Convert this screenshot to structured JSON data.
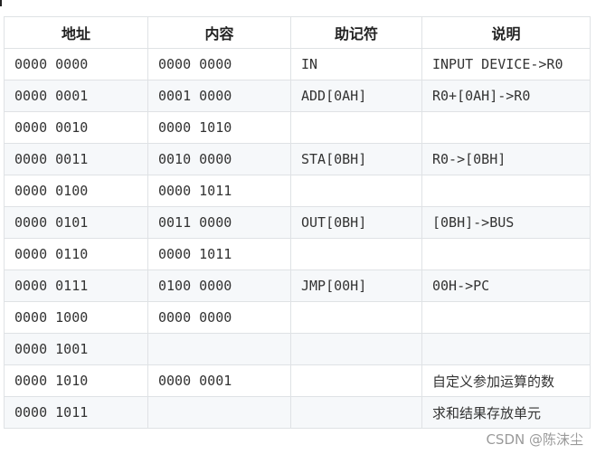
{
  "table": {
    "headers": [
      "地址",
      "内容",
      "助记符",
      "说明"
    ],
    "rows": [
      {
        "address": "0000 0000",
        "content": "0000 0000",
        "mnemonic": "IN",
        "note": "INPUT DEVICE->R0"
      },
      {
        "address": "0000 0001",
        "content": "0001 0000",
        "mnemonic": "ADD[0AH]",
        "note": "R0+[0AH]->R0"
      },
      {
        "address": "0000 0010",
        "content": "0000 1010",
        "mnemonic": "",
        "note": ""
      },
      {
        "address": "0000 0011",
        "content": "0010 0000",
        "mnemonic": "STA[0BH]",
        "note": "R0->[0BH]"
      },
      {
        "address": "0000 0100",
        "content": "0000 1011",
        "mnemonic": "",
        "note": ""
      },
      {
        "address": "0000 0101",
        "content": "0011 0000",
        "mnemonic": "OUT[0BH]",
        "note": "[0BH]->BUS"
      },
      {
        "address": "0000 0110",
        "content": "0000 1011",
        "mnemonic": "",
        "note": ""
      },
      {
        "address": "0000 0111",
        "content": "0100 0000",
        "mnemonic": "JMP[00H]",
        "note": "00H->PC"
      },
      {
        "address": "0000 1000",
        "content": "0000 0000",
        "mnemonic": "",
        "note": ""
      },
      {
        "address": "0000 1001",
        "content": "",
        "mnemonic": "",
        "note": ""
      },
      {
        "address": "0000 1010",
        "content": "0000 0001",
        "mnemonic": "",
        "note": "自定义参加运算的数"
      },
      {
        "address": "0000 1011",
        "content": "",
        "mnemonic": "",
        "note": "求和结果存放单元"
      }
    ]
  },
  "watermark": "CSDN @陈沫尘",
  "colors": {
    "border": "#dfe2e5",
    "stripe": "#f6f8fa",
    "text": "#333333"
  }
}
